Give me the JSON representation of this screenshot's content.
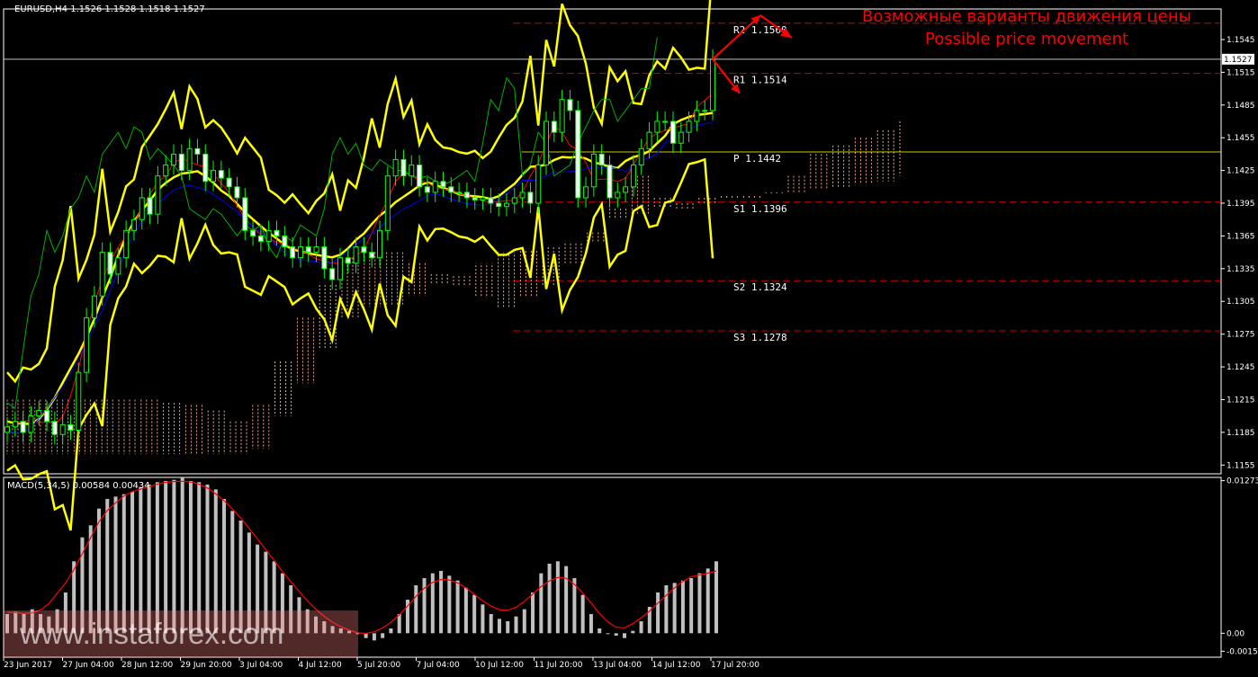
{
  "window": {
    "title": "EURUSD,H4",
    "ohlc": "1.1526 1.1528 1.1518 1.1527",
    "macd_title": "MACD(5,34,5) 0.00584 0.00434",
    "watermark": "www.instaforex.com"
  },
  "annotations": {
    "ru": "Возможные варианты движения цены",
    "en": "Possible price movement"
  },
  "chart_data": [
    {
      "type": "candlestick",
      "symbol": "EURUSD",
      "timeframe": "H4",
      "ylim": [
        1.1147,
        1.1573
      ],
      "y_ticks": [
        "1.1545",
        "1.1515",
        "1.1485",
        "1.1455",
        "1.1425",
        "1.1395",
        "1.1365",
        "1.1335",
        "1.1305",
        "1.1275",
        "1.1245",
        "1.1215",
        "1.1185",
        "1.1155"
      ],
      "current_price": "1.1527",
      "x_tick_labels": [
        "23 Jun 2017",
        "27 Jun 04:00",
        "28 Jun 12:00",
        "29 Jun 20:00",
        "3 Jul 04:00",
        "4 Jul 12:00",
        "5 Jul 20:00",
        "7 Jul 04:00",
        "10 Jul 12:00",
        "11 Jul 20:00",
        "13 Jul 04:00",
        "14 Jul 12:00",
        "17 Jul 20:00"
      ],
      "pivot_levels": [
        {
          "label": "R2",
          "value": "1.1560"
        },
        {
          "label": "R1",
          "value": "1.1514"
        },
        {
          "label": "P",
          "value": "1.1442"
        },
        {
          "label": "S1",
          "value": "1.1396"
        },
        {
          "label": "S2",
          "value": "1.1324"
        },
        {
          "label": "S3",
          "value": "1.1278"
        }
      ],
      "close_series": [
        1.119,
        1.1195,
        1.1185,
        1.12,
        1.1205,
        1.1195,
        1.1183,
        1.1192,
        1.1187,
        1.124,
        1.129,
        1.131,
        1.135,
        1.133,
        1.1345,
        1.137,
        1.138,
        1.14,
        1.1385,
        1.142,
        1.143,
        1.144,
        1.1425,
        1.1445,
        1.144,
        1.1415,
        1.1425,
        1.1418,
        1.141,
        1.14,
        1.137,
        1.1365,
        1.136,
        1.137,
        1.1365,
        1.1355,
        1.1345,
        1.1355,
        1.135,
        1.1355,
        1.1335,
        1.1325,
        1.1345,
        1.134,
        1.1355,
        1.135,
        1.1345,
        1.137,
        1.142,
        1.1435,
        1.142,
        1.143,
        1.141,
        1.1405,
        1.1415,
        1.141,
        1.1405,
        1.1405,
        1.14,
        1.1398,
        1.14,
        1.1395,
        1.1392,
        1.1395,
        1.14,
        1.1405,
        1.1395,
        1.143,
        1.147,
        1.146,
        1.149,
        1.148,
        1.14,
        1.141,
        1.144,
        1.143,
        1.14,
        1.1405,
        1.141,
        1.143,
        1.1445,
        1.146,
        1.147,
        1.147,
        1.145,
        1.146,
        1.147,
        1.148,
        1.148,
        1.1527
      ],
      "indicators": [
        {
          "name": "Bollinger Bands",
          "color": "#ffff00"
        },
        {
          "name": "Ichimoku Tenkan-sen",
          "color": "#ff0000"
        },
        {
          "name": "Ichimoku Kijun-sen",
          "color": "#0000ff"
        },
        {
          "name": "Ichimoku Chikou Span",
          "color": "#00c000"
        },
        {
          "name": "Ichimoku Kumo",
          "color": "#ffb0a0"
        }
      ]
    },
    {
      "type": "bar",
      "name": "MACD(5,34,5)",
      "ylim": [
        -0.002,
        0.013
      ],
      "y_ticks": [
        "0.01273",
        "0.00",
        "-0.0015"
      ],
      "values": [
        0.0016,
        0.0018,
        0.0016,
        0.002,
        0.0016,
        0.0014,
        0.002,
        0.0034,
        0.006,
        0.008,
        0.009,
        0.0104,
        0.0112,
        0.0114,
        0.0116,
        0.0118,
        0.0122,
        0.0124,
        0.0126,
        0.0127,
        0.0128,
        0.013,
        0.0127,
        0.0126,
        0.0124,
        0.012,
        0.0112,
        0.0102,
        0.0094,
        0.0084,
        0.0074,
        0.0068,
        0.006,
        0.005,
        0.004,
        0.003,
        0.002,
        0.0014,
        0.001,
        0.0006,
        0.0004,
        0.0002,
        0.0,
        -0.0004,
        -0.0006,
        -0.0004,
        0.0004,
        0.0016,
        0.0028,
        0.004,
        0.0046,
        0.005,
        0.0052,
        0.0048,
        0.0044,
        0.0038,
        0.0032,
        0.0024,
        0.0016,
        0.0012,
        0.001,
        0.0014,
        0.002,
        0.0034,
        0.005,
        0.0058,
        0.006,
        0.0056,
        0.0046,
        0.0032,
        0.0016,
        0.0004,
        0.0,
        -0.0002,
        -0.0004,
        0.0002,
        0.001,
        0.0022,
        0.0034,
        0.004,
        0.0042,
        0.0044,
        0.0046,
        0.005,
        0.0054,
        0.006
      ],
      "signal_color": "#ff0000"
    }
  ]
}
